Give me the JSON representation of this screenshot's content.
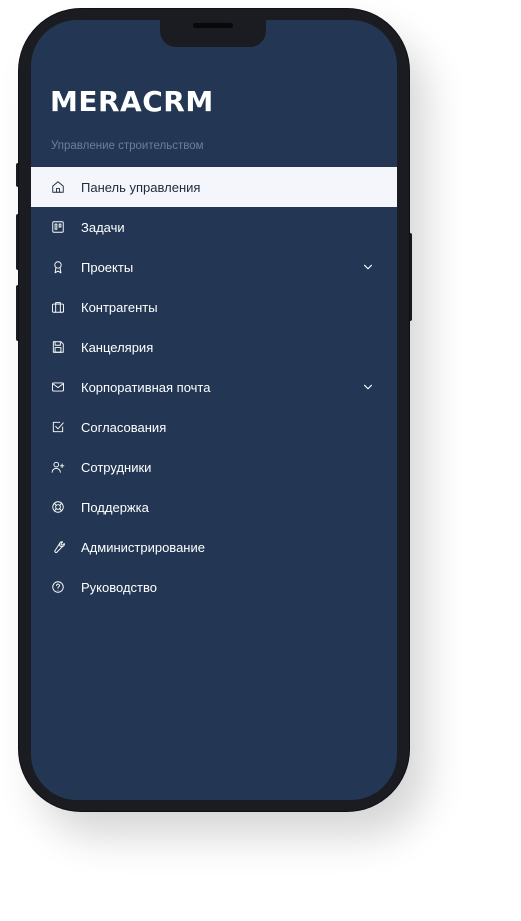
{
  "app": {
    "logo": "MERACRM",
    "subtitle": "Управление строительством"
  },
  "colors": {
    "sidebar_bg": "#233754",
    "active_bg": "#f4f6fb",
    "subtitle_text": "#6d7f99",
    "phone_frame": "#1b1c21"
  },
  "menu": {
    "items": [
      {
        "label": "Панель управления",
        "icon": "home-icon",
        "active": true,
        "has_submenu": false
      },
      {
        "label": "Задачи",
        "icon": "kanban-icon",
        "active": false,
        "has_submenu": false
      },
      {
        "label": "Проекты",
        "icon": "award-icon",
        "active": false,
        "has_submenu": true
      },
      {
        "label": "Контрагенты",
        "icon": "briefcase-icon",
        "active": false,
        "has_submenu": false
      },
      {
        "label": "Канцелярия",
        "icon": "floppy-disk-icon",
        "active": false,
        "has_submenu": false
      },
      {
        "label": "Корпоративная почта",
        "icon": "mail-icon",
        "active": false,
        "has_submenu": true
      },
      {
        "label": "Согласования",
        "icon": "check-square-icon",
        "active": false,
        "has_submenu": false
      },
      {
        "label": "Сотрудники",
        "icon": "user-plus-icon",
        "active": false,
        "has_submenu": false
      },
      {
        "label": "Поддержка",
        "icon": "lifebuoy-icon",
        "active": false,
        "has_submenu": false
      },
      {
        "label": "Администрирование",
        "icon": "wrench-icon",
        "active": false,
        "has_submenu": false
      },
      {
        "label": "Руководство",
        "icon": "help-circle-icon",
        "active": false,
        "has_submenu": false
      }
    ]
  }
}
